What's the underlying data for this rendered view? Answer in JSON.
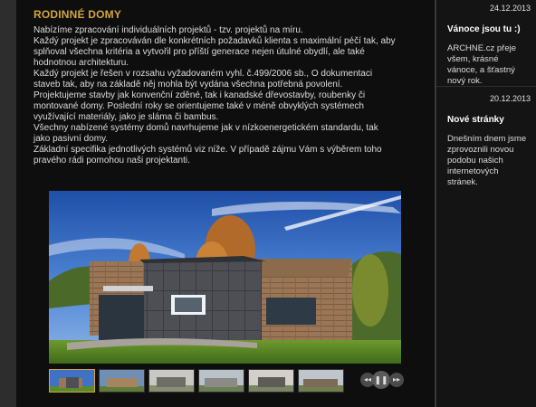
{
  "article": {
    "title": "RODINNÉ DOMY",
    "paragraphs": [
      "Nabízíme zpracování individuálních projektů - tzv. projektů na míru.",
      "Každý projekt je zpracováván dle konkrétních požadavků klienta s maximální péčí tak, aby splňoval všechna kritéria a vytvořil pro příští generace nejen útulné obydlí, ale také hodnotnou architekturu.",
      "Každý projekt je řešen v rozsahu vyžadovaném vyhl. č.499/2006 sb., O dokumentaci staveb tak, aby na základě něj mohla být vydána všechna potřebná povolení.",
      "Projektujeme stavby jak konvenční zděné, tak i kanadské dřevostavby, roubenky či montované domy. Poslední roky se orientujeme také v méně obvyklých systémech využívající materiály, jako je sláma či bambus.",
      "Všechny nabízené systémy domů navrhujeme jak v nízkoenergetickém standardu, tak jako pasivní domy.",
      "Základní specifika jednotlivých systémů viz níže. V případě zájmu Vám s výběrem toho pravého rádi pomohou naši projektanti."
    ]
  },
  "gallery": {
    "controls": {
      "prev_icon": "rewind-icon",
      "play_icon": "pause-icon",
      "next_icon": "forward-icon",
      "prev_glyph": "◂◂",
      "play_glyph": "❚❚",
      "next_glyph": "▸▸"
    }
  },
  "sidebar": {
    "news": [
      {
        "date": "24.12.2013",
        "title": "Vánoce jsou tu :)",
        "text": "ARCHNE.cz přeje všem, krásné vánoce, a šťastný nový rok."
      },
      {
        "date": "20.12.2013",
        "title": "Nové stránky",
        "text": "Dnešním dnem jsme zprovoznili novou podobu našich internetových stránek."
      }
    ]
  },
  "colors": {
    "accent": "#d4a53c",
    "background": "#0e0e0e",
    "text": "#dcdcdc"
  }
}
